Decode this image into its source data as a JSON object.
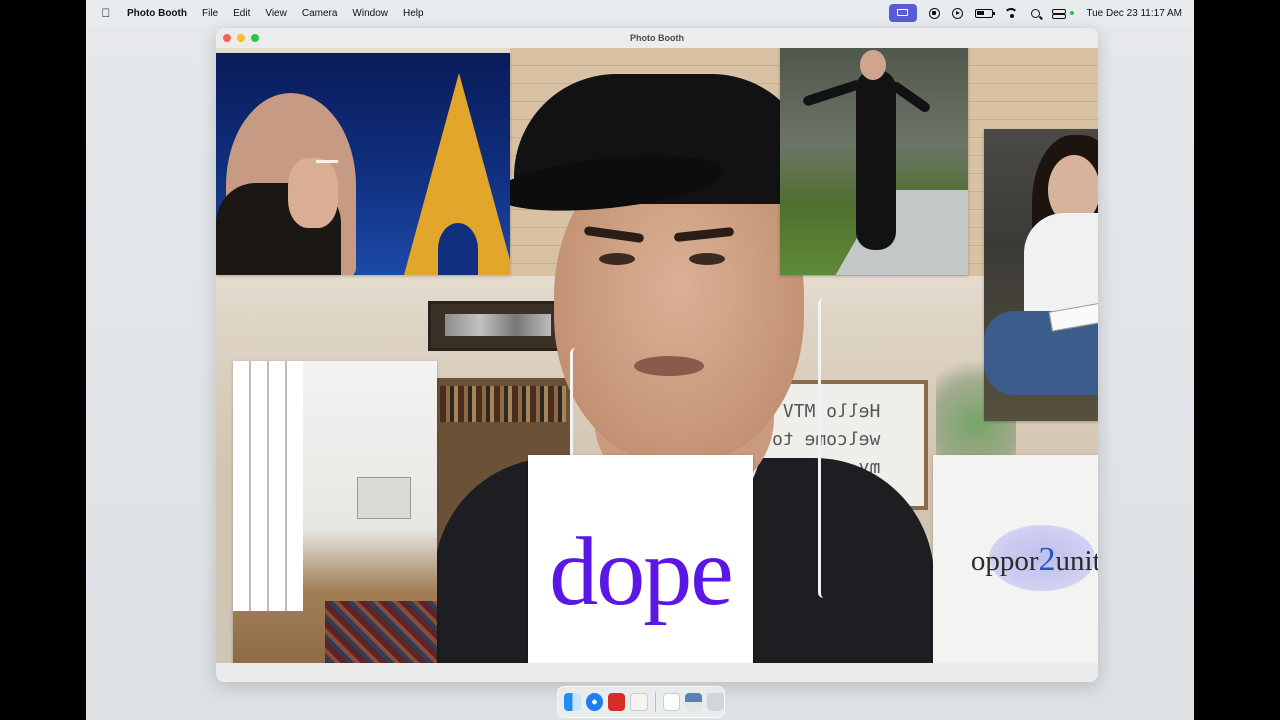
{
  "menubar": {
    "app_name": "Photo Booth",
    "menus": [
      "File",
      "Edit",
      "View",
      "Camera",
      "Window",
      "Help"
    ],
    "clock": "Tue Dec 23  11:17 AM",
    "status_icons": [
      "screen-share-icon",
      "display-icon",
      "play-icon",
      "battery-icon",
      "wifi-icon",
      "search-icon",
      "control-center-icon"
    ]
  },
  "window": {
    "title": "Photo Booth"
  },
  "cutouts": {
    "dope_text": "dope",
    "opportunity_pre": "oppor",
    "opportunity_two": "2",
    "opportunity_post": "unity",
    "whiteboard_text": "Hello MTV\nwelcome to\nmy..."
  },
  "dock": {
    "items": [
      "finder-icon",
      "safari-icon",
      "photo-booth-icon",
      "notes-icon",
      "document-icon",
      "preview-icon",
      "trash-icon"
    ]
  },
  "colors": {
    "dope_purple": "#5b17e6",
    "two_blue": "#2853c9",
    "screen_share_accent": "#5a5cd6"
  }
}
